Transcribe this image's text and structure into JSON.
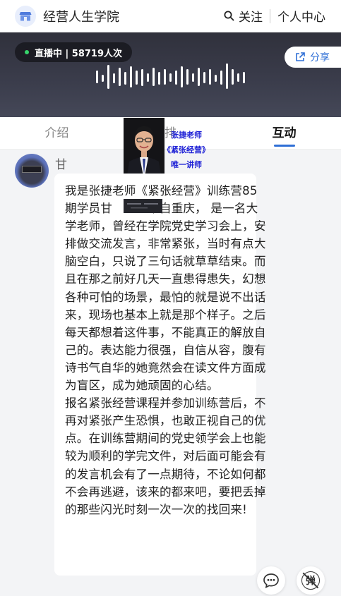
{
  "header": {
    "site_title": "经营人生学院",
    "follow_label": "关注",
    "personal_center_label": "个人中心"
  },
  "banner": {
    "live_status": "直播中 | 58719人次",
    "share_label": "分享"
  },
  "tabs": [
    {
      "label": "介绍",
      "active": false
    },
    {
      "label": "排",
      "active": false
    },
    {
      "label": "互动",
      "active": true
    }
  ],
  "teacher_overlay": {
    "line1": "张捷老师",
    "line2": "《紧张经营》",
    "line3": "唯一讲师"
  },
  "message": {
    "sender_name": "甘",
    "paragraphs": [
      "我是张捷老师《紧张经营》训练营85期学员甘　　　来自重庆， 是一名大学老师，曾经在学院党史学习会上，安排做交流发言，非常紧张，当时有点大脑空白，只说了三句话就草草结束。而且在那之前好几天一直患得患失，幻想各种可怕的场景，最怕的就是说不出话来，现场也基本上就是那个样子。之后每天都想着这件事，不能真正的解放自己的。表达能力很强，自信从容，腹有诗书气自华的她竟然会在读文件方面成为盲区，成为她顽固的心结。",
      "报名紧张经营课程并参加训练营后，不再对紧张产生恐惧，也敢正视自己的优点。在训练营期间的党史领学会上也能较为顺利的学完文件，对后面可能会有的发言机会有了一点期待，不论如何都不会再逃避，该来的都来吧，要把丢掉的那些闪光时刻一次一次的找回来!"
    ]
  },
  "floating": {
    "danmaku_label": "弹"
  },
  "colors": {
    "accent": "#2f6fd6",
    "live_dot": "#36d46b",
    "teacher_text": "#1f22d6",
    "page_bg": "#f3f4f6"
  },
  "icons": [
    "store-icon",
    "search-icon",
    "share-icon",
    "sound-wave-icon",
    "chat-bubble-icon",
    "danmaku-off-icon"
  ]
}
